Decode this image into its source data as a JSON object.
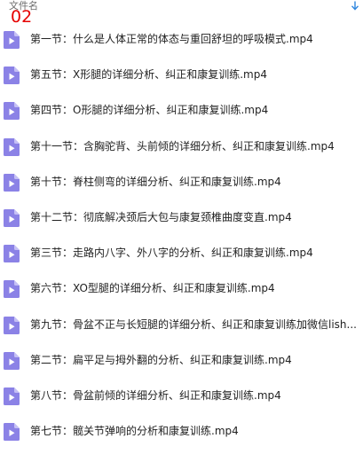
{
  "header": {
    "column_label": "文件名",
    "overlay_number": "02"
  },
  "colors": {
    "accent_blue": "#2e86de",
    "overlay_red": "#e60000",
    "icon_purple": "#8b82e6"
  },
  "files": [
    {
      "name": "第一节：什么是人体正常的体态与重回舒坦的呼吸模式.mp4",
      "icon": "video-file-icon"
    },
    {
      "name": "第五节：X形腿的详细分析、纠正和康复训练.mp4",
      "icon": "video-file-icon"
    },
    {
      "name": "第四节：O形腿的详细分析、纠正和康复训练.mp4",
      "icon": "video-file-icon"
    },
    {
      "name": "第十一节：含胸驼背、头前倾的详细分析、纠正和康复训练.mp4",
      "icon": "video-file-icon"
    },
    {
      "name": "第十节：脊柱侧弯的详细分析、纠正和康复训练.mp4",
      "icon": "video-file-icon"
    },
    {
      "name": "第十二节：彻底解决颈后大包与康复颈椎曲度变直.mp4",
      "icon": "video-file-icon"
    },
    {
      "name": "第三节：走路内八字、外八字的分析、纠正和康复训练.mp4",
      "icon": "video-file-icon"
    },
    {
      "name": "第六节：XO型腿的详细分析、纠正和康复训练.mp4",
      "icon": "video-file-icon"
    },
    {
      "name": "第九节：骨盆不正与长短腿的详细分析、纠正和康复训练加微信lish...",
      "icon": "video-file-icon"
    },
    {
      "name": "第二节：扁平足与拇外翻的分析、纠正和康复训练.mp4",
      "icon": "video-file-icon"
    },
    {
      "name": "第八节：骨盆前倾的详细分析、纠正和康复训练.mp4",
      "icon": "video-file-icon"
    },
    {
      "name": "第七节：髋关节弹响的分析和康复训练.mp4",
      "icon": "video-file-icon"
    }
  ]
}
